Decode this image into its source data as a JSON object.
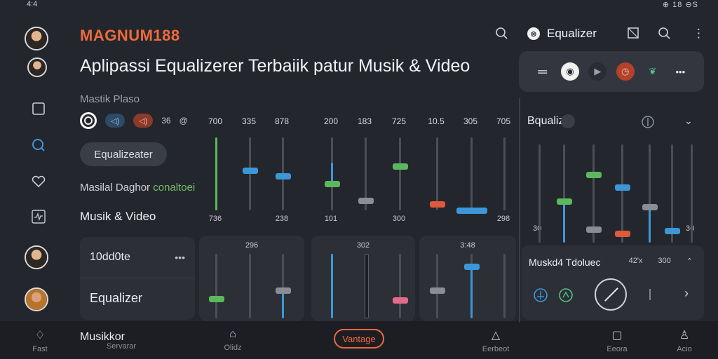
{
  "status_bar": {
    "time": "4:4",
    "indicators": "⊕ 18 ⊖S"
  },
  "header": {
    "brand": "MAGNUM188",
    "headline": "Aplipassi Equalizerer Terbaiik patur Musik & Video",
    "subtitle": "Mastik Plaso",
    "chip": "Equalizeater",
    "line2_prefix": "Masilal Daghor ",
    "line2_green": "conaltoei",
    "line3": "Musik & Video"
  },
  "controls": {
    "pill1": "◁)",
    "pill2": "◁)",
    "val1": "36",
    "val2": "@",
    "val3": "@"
  },
  "equalizer": {
    "freqs": [
      "700",
      "335",
      "878",
      "200",
      "183",
      "725",
      "10.5",
      "305",
      "705"
    ],
    "values_bottom": [
      "736",
      "238",
      "101",
      "300",
      "298"
    ],
    "bands": [
      {
        "color": "#5cb85c",
        "level": 1.0,
        "filled": true
      },
      {
        "color": "#3c97d9",
        "level": 0.5
      },
      {
        "color": "#3c97d9",
        "level": 0.42
      },
      {
        "color": "#5cb85c",
        "level": 0.3,
        "accent": "#3c97d9"
      },
      {
        "color": "#8a8d93",
        "level": 0.05
      },
      {
        "color": "#5cb85c",
        "level": 0.57
      },
      {
        "color": "#e0593a",
        "level": 0.0
      },
      {
        "color": "#3c97d9",
        "level": -0.1,
        "wide": true
      },
      {
        "color": "#4a4e57",
        "level": 0.0
      }
    ]
  },
  "left_card": {
    "row1": "10dd0te",
    "row2": "Equalizer",
    "dots": "•••"
  },
  "mid_cards": [
    {
      "label": "296"
    },
    {
      "label": "302"
    },
    {
      "label": "3:48"
    }
  ],
  "bottom_nav": {
    "items": [
      "Fast",
      "Servarar",
      "Olidz",
      "Eerbeot",
      "Eeora",
      "Acio"
    ],
    "musikkor": "Musikkor",
    "center": "Vantage"
  },
  "right_panel": {
    "title": "Equalizer",
    "logo": "⊗",
    "eq_title": "Bqualiz",
    "card_title": "Muskd4 Tdoluec",
    "card_val1": "42'x",
    "card_val2": "300",
    "axis_left": "30",
    "axis_right": "30"
  },
  "colors": {
    "accent": "#ef6a3b",
    "green": "#5cb85c",
    "blue": "#3c97d9",
    "red": "#e0593a"
  }
}
